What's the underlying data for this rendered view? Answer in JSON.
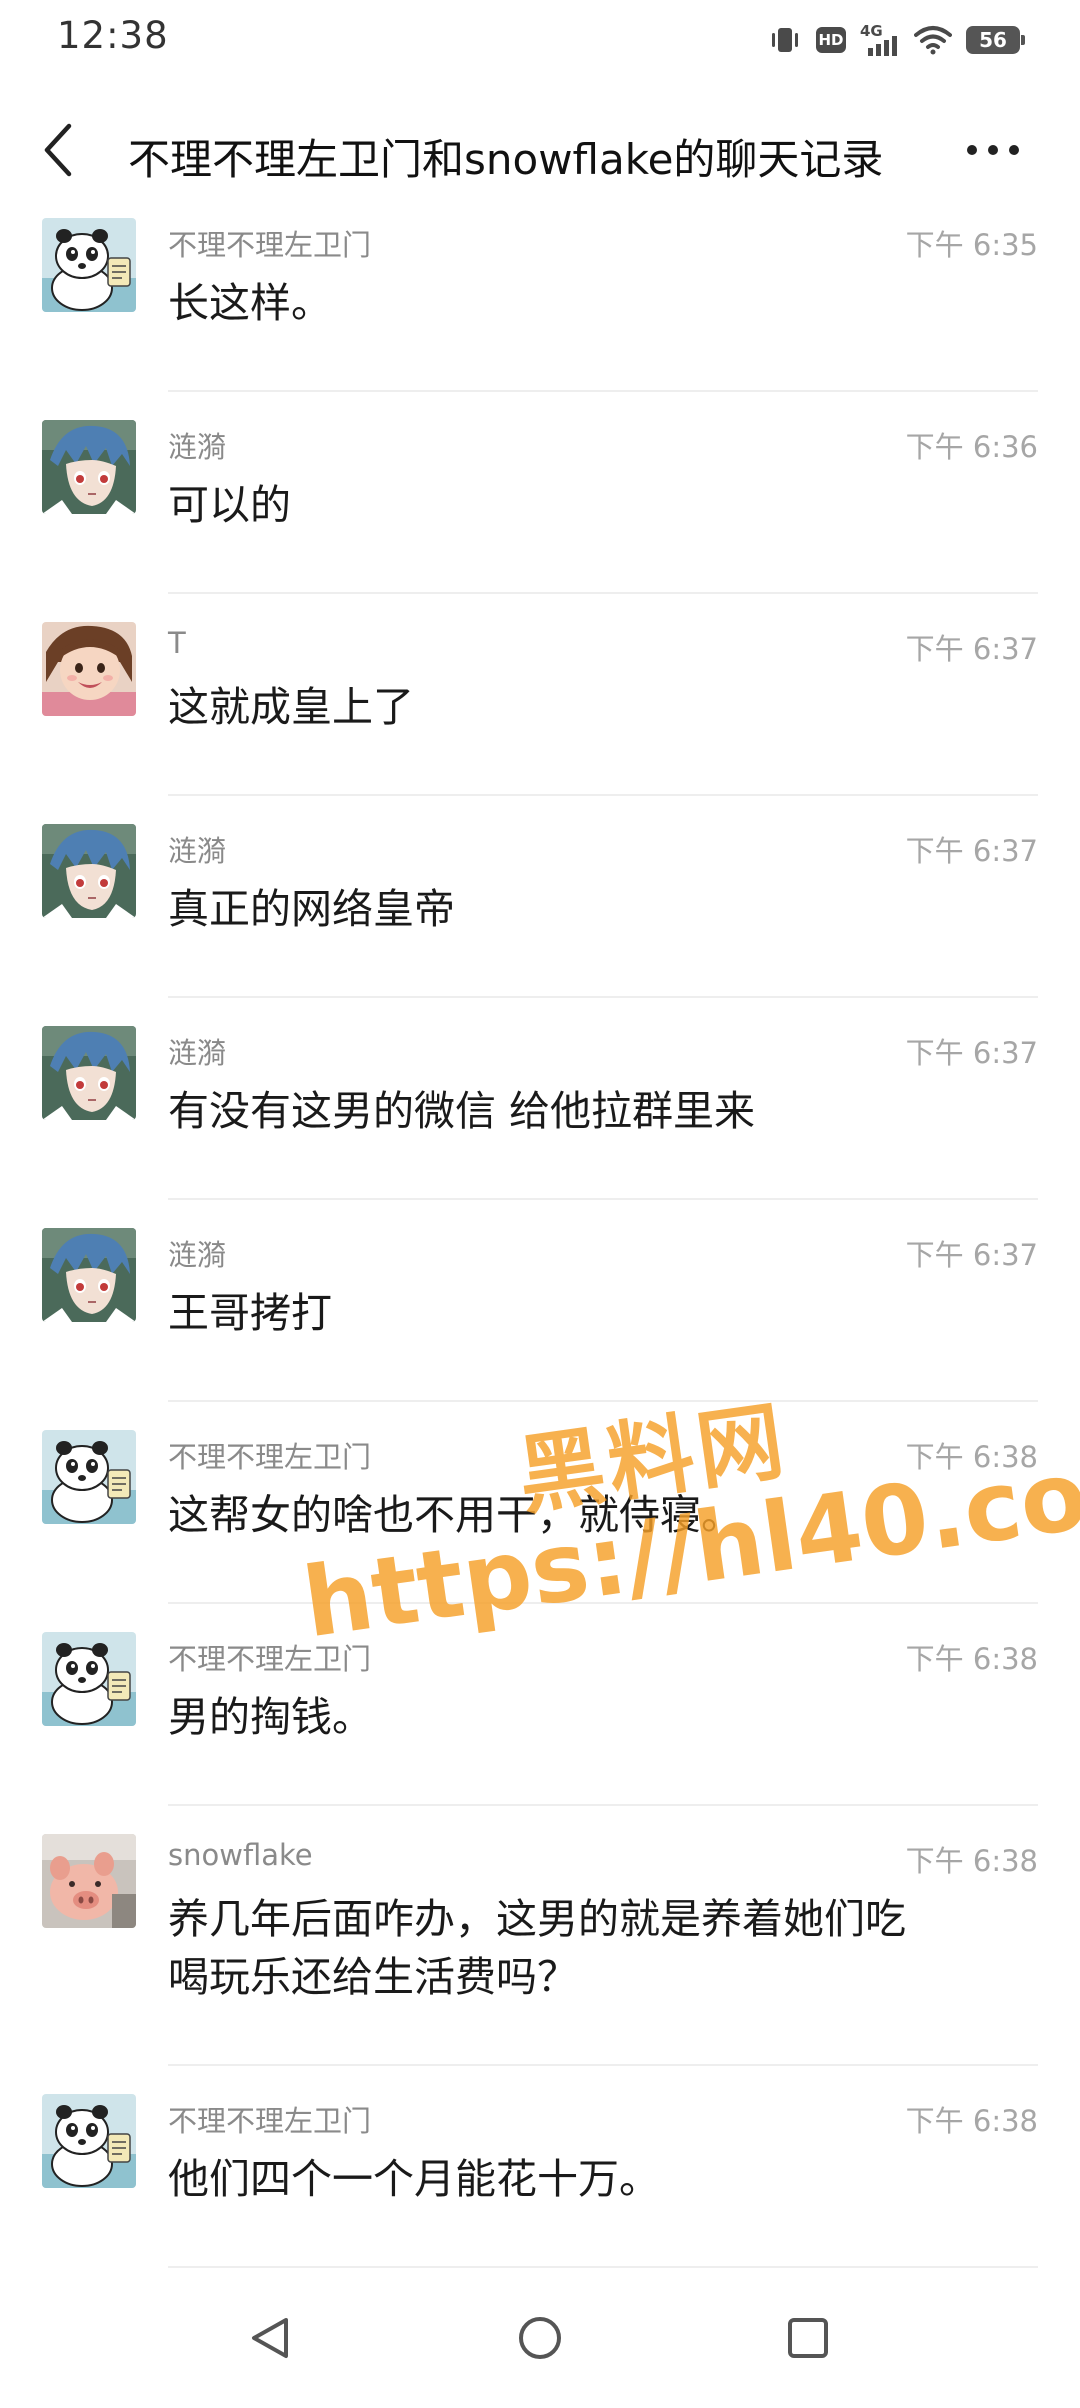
{
  "status_bar": {
    "time": "12:38",
    "network_label": "4G",
    "hd_label": "HD",
    "battery_level": "56",
    "icons": [
      "vibrate-icon",
      "hd-icon",
      "cellular-4g-icon",
      "wifi-icon",
      "battery-icon"
    ]
  },
  "header": {
    "title": "不理不理左卫门和snowflake的聊天记录",
    "back_icon": "chevron-left-icon",
    "more_icon": "more-dots-icon"
  },
  "messages": [
    {
      "sender": "不理不理左卫门",
      "time": "下午 6:35",
      "lines": [
        "长这样。"
      ],
      "avatar": "panda"
    },
    {
      "sender": "涟漪",
      "time": "下午 6:36",
      "lines": [
        "可以的"
      ],
      "avatar": "anime"
    },
    {
      "sender": "T",
      "time": "下午 6:37",
      "lines": [
        "这就成皇上了"
      ],
      "avatar": "child"
    },
    {
      "sender": "涟漪",
      "time": "下午 6:37",
      "lines": [
        "真正的网络皇帝"
      ],
      "avatar": "anime"
    },
    {
      "sender": "涟漪",
      "time": "下午 6:37",
      "lines": [
        "有没有这男的微信 给他拉群里来"
      ],
      "avatar": "anime"
    },
    {
      "sender": "涟漪",
      "time": "下午 6:37",
      "lines": [
        "王哥拷打"
      ],
      "avatar": "anime"
    },
    {
      "sender": "不理不理左卫门",
      "time": "下午 6:38",
      "lines": [
        "这帮女的啥也不用干，就侍寝。"
      ],
      "avatar": "panda"
    },
    {
      "sender": "不理不理左卫门",
      "time": "下午 6:38",
      "lines": [
        "男的掏钱。"
      ],
      "avatar": "panda"
    },
    {
      "sender": "snowflake",
      "time": "下午 6:38",
      "lines": [
        "养几年后面咋办，这男的就是养着她们吃",
        "喝玩乐还给生活费吗？"
      ],
      "avatar": "pig"
    },
    {
      "sender": "不理不理左卫门",
      "time": "下午 6:38",
      "lines": [
        "他们四个一个月能花十万。"
      ],
      "avatar": "panda"
    }
  ],
  "watermark": {
    "line1": "黑料网",
    "line2": "https://hl40.co"
  },
  "nav_bar": {
    "icons": [
      "nav-back-icon",
      "nav-home-icon",
      "nav-recents-icon"
    ]
  },
  "colors": {
    "watermark": "#f5a028",
    "sender": "#8a8a8a",
    "time": "#a6a6a6",
    "divider": "#eeeeee"
  }
}
